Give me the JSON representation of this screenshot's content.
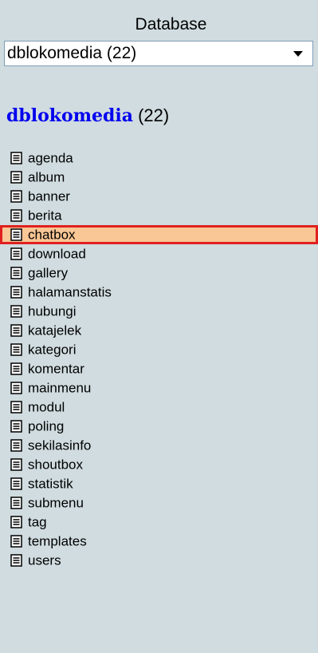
{
  "database": {
    "label": "Database",
    "selected": "dblokomedia (22)",
    "heading_name": "dblokomedia",
    "heading_count": "(22)"
  },
  "tables": [
    {
      "name": "agenda",
      "icon": "table-icon"
    },
    {
      "name": "album",
      "icon": "table-icon"
    },
    {
      "name": "banner",
      "icon": "table-icon"
    },
    {
      "name": "berita",
      "icon": "table-icon"
    },
    {
      "name": "chatbox",
      "icon": "table-icon",
      "selected": true
    },
    {
      "name": "download",
      "icon": "table-icon"
    },
    {
      "name": "gallery",
      "icon": "table-icon"
    },
    {
      "name": "halamanstatis",
      "icon": "table-icon"
    },
    {
      "name": "hubungi",
      "icon": "table-icon"
    },
    {
      "name": "katajelek",
      "icon": "table-icon"
    },
    {
      "name": "kategori",
      "icon": "table-icon"
    },
    {
      "name": "komentar",
      "icon": "table-icon"
    },
    {
      "name": "mainmenu",
      "icon": "table-icon"
    },
    {
      "name": "modul",
      "icon": "table-icon"
    },
    {
      "name": "poling",
      "icon": "table-icon"
    },
    {
      "name": "sekilasinfo",
      "icon": "table-icon"
    },
    {
      "name": "shoutbox",
      "icon": "table-icon"
    },
    {
      "name": "statistik",
      "icon": "table-icon"
    },
    {
      "name": "submenu",
      "icon": "table-icon"
    },
    {
      "name": "tag",
      "icon": "table-icon"
    },
    {
      "name": "templates",
      "icon": "table-icon"
    },
    {
      "name": "users",
      "icon": "table-icon"
    }
  ],
  "colors": {
    "panel_background": "#d0dce0",
    "link": "#0000ee",
    "selected_fill": "#f9c695",
    "selected_border": "#e02020"
  }
}
